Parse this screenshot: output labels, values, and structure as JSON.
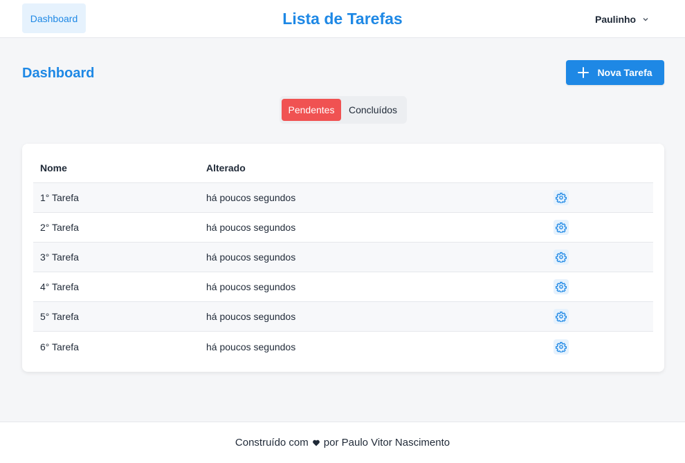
{
  "header": {
    "nav_dashboard": "Dashboard",
    "app_title": "Lista de Tarefas",
    "user_name": "Paulinho",
    "user_menu_icon": "chevron-down-icon"
  },
  "main": {
    "page_title": "Dashboard",
    "new_task_label": "Nova Tarefa",
    "new_task_icon": "plus-icon",
    "tabs": [
      {
        "label": "Pendentes",
        "active": true
      },
      {
        "label": "Concluídos",
        "active": false
      }
    ],
    "table": {
      "columns": [
        "Nome",
        "Alterado",
        ""
      ],
      "rows": [
        {
          "name": "1° Tarefa",
          "changed": "há poucos segundos",
          "action_icon": "gear-icon"
        },
        {
          "name": "2° Tarefa",
          "changed": "há poucos segundos",
          "action_icon": "gear-icon"
        },
        {
          "name": "3° Tarefa",
          "changed": "há poucos segundos",
          "action_icon": "gear-icon"
        },
        {
          "name": "4° Tarefa",
          "changed": "há poucos segundos",
          "action_icon": "gear-icon"
        },
        {
          "name": "5° Tarefa",
          "changed": "há poucos segundos",
          "action_icon": "gear-icon"
        },
        {
          "name": "6° Tarefa",
          "changed": "há poucos segundos",
          "action_icon": "gear-icon"
        }
      ]
    }
  },
  "footer": {
    "prefix": "Construído com",
    "heart_icon": "heart-icon",
    "suffix": "por Paulo Vitor Nascimento"
  },
  "colors": {
    "accent": "#1e88e5",
    "danger": "#f05252",
    "background": "#f5f6f8"
  }
}
